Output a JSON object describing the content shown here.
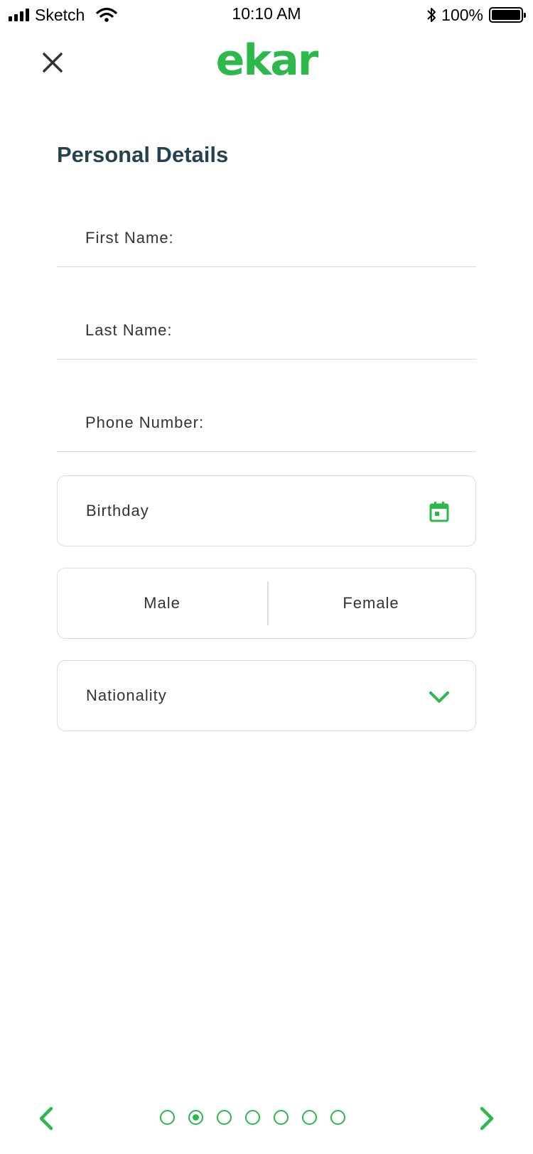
{
  "status_bar": {
    "carrier": "Sketch",
    "time": "10:10 AM",
    "battery": "100%",
    "battery_level": 1.0
  },
  "header": {
    "logo_text": "ekar",
    "close_icon": "close-icon"
  },
  "page": {
    "title": "Personal Details"
  },
  "form": {
    "first_name_label": "First Name:",
    "last_name_label": "Last Name:",
    "phone_label": "Phone Number:",
    "birthday_label": "Birthday",
    "birthday_icon": "calendar-icon",
    "gender_male": "Male",
    "gender_female": "Female",
    "nationality_label": "Nationality",
    "nationality_icon": "chevron-down-icon"
  },
  "pager": {
    "total_steps": 7,
    "current_step": 2,
    "prev_icon": "chevron-left-icon",
    "next_icon": "chevron-right-icon"
  },
  "colors": {
    "accent": "#2db84b",
    "title": "#26424f",
    "border": "#dcdcdc"
  }
}
